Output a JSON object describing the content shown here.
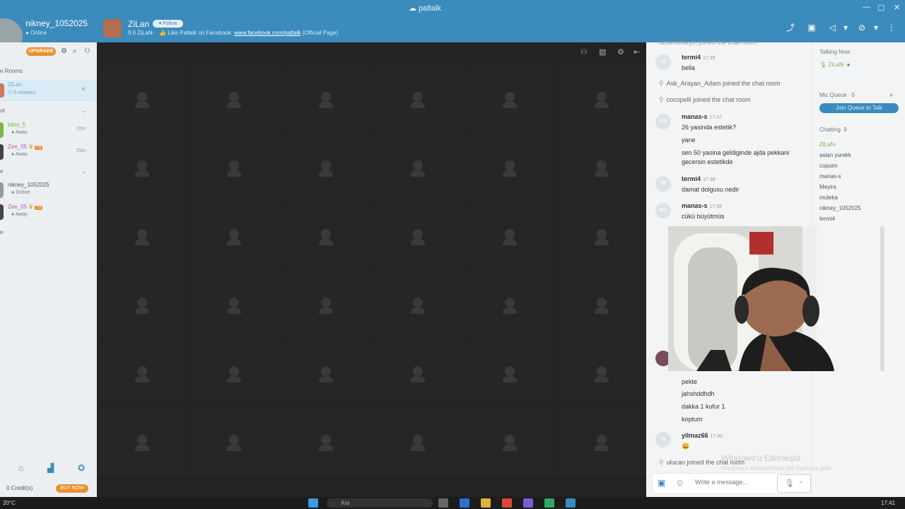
{
  "app": {
    "logo_text": "paltalk",
    "profile_name": "nikney_1052025",
    "profile_status": "Online"
  },
  "room": {
    "name": "ZiLan",
    "follow_label": "Follow",
    "meta_counts": "9   0   ZiLaN-",
    "meta_text": "Like Paltalk on Facebook:",
    "meta_link": "www.facebook.com/paltalk",
    "meta_suffix": "(Official Page)"
  },
  "sidebar": {
    "upgrade_label": "UPGRADE",
    "rooms_section": "e Rooms",
    "room_item_name": "ZiLan",
    "room_item_meta": "9 chatters",
    "section2": "ot",
    "section3": "e",
    "section4": "e",
    "contacts_a": [
      {
        "name": "bilos_5",
        "status": "Away",
        "time": "20m",
        "color": "#7ab648",
        "name_color": "#7ab648"
      },
      {
        "name": "Zee_05",
        "status": "Away",
        "time": "25m",
        "color": "#444",
        "name_color": "#b060b8",
        "badge": "73"
      }
    ],
    "contacts_b": [
      {
        "name": "nikney_1052025",
        "status": "Online",
        "color": "#999",
        "name_color": "#555"
      },
      {
        "name": "Zee_05",
        "status": "Away",
        "color": "#444",
        "name_color": "#b060b8",
        "badge": "73"
      }
    ],
    "credits": "0 Credit(s)",
    "buy_now": "BUY NOW"
  },
  "chat": {
    "system_top": "ozdemirbeyin joined the chat room",
    "messages": [
      {
        "name": "termi4",
        "time": "17:35",
        "av": "TE",
        "lines": [
          "bella"
        ]
      },
      {
        "name": "manas-s",
        "time": "17:37",
        "av": "MA",
        "lines": [
          "26 yasinda estetik?",
          "yane",
          "sen 50 yasina geldiginde ajda pekkani gecersin estetikde"
        ]
      },
      {
        "name": "termi4",
        "time": "17:38",
        "av": "TE",
        "lines": [
          "damat dolgusu nedir"
        ]
      },
      {
        "name": "manas-s",
        "time": "17:38",
        "av": "MA",
        "lines": [
          "cükü büyütmüs"
        ]
      },
      {
        "name": "yilmaz66",
        "time": "17:40",
        "av": "YI",
        "lines": [
          "😀"
        ]
      }
    ],
    "system": [
      "Ask_Arayan_Adam joined the chat room",
      "cocopelli joined the chat room",
      "ulucan joined the chat room"
    ],
    "lower_lines": [
      "pekte",
      "jahshddhdh",
      "dakka 1 kufur 1",
      "koptum"
    ],
    "input_placeholder": "Write a message..."
  },
  "right_panel": {
    "talking_now": "Talking Now",
    "talking_user": "ZiLaN-",
    "mic_queue": "Mic Queue",
    "mic_queue_count": "0",
    "join_queue": "Join Queue to Talk",
    "chatting": "Chatting",
    "chatting_count": "9",
    "users": [
      "ZiLaN-",
      "aslan yurekk",
      "copuim",
      "manas-s",
      "Meyira",
      "muleka",
      "nikney_1052025",
      "termi4"
    ]
  },
  "watermark": {
    "line1": "Windows'u Etkinleştir",
    "line2": "Windows'u etkinleştirmek için Ayarlar'a gidin."
  },
  "taskbar": {
    "weather": "20°C",
    "search": "Ara",
    "clock": "17:41"
  }
}
